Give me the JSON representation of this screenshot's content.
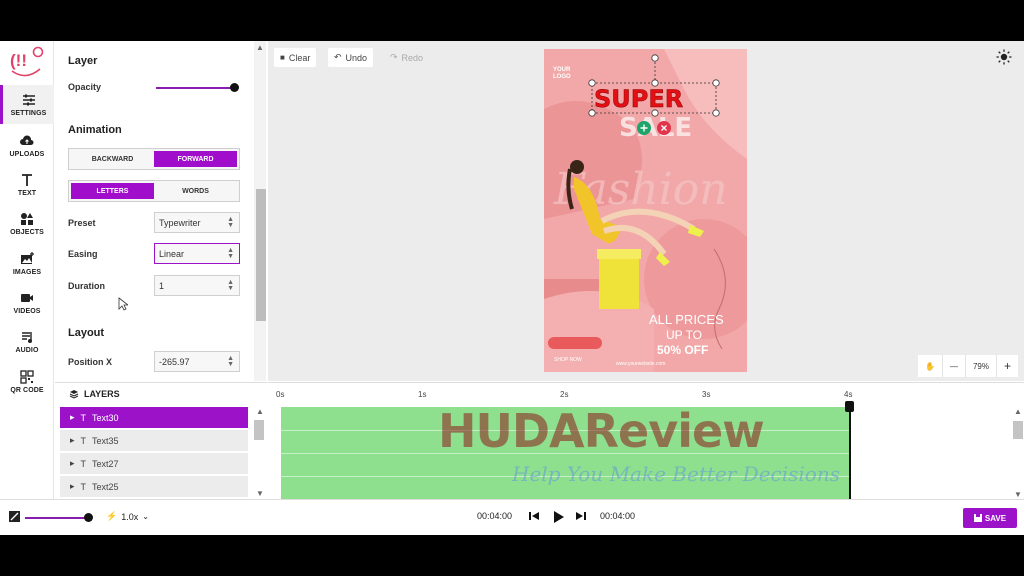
{
  "rail": {
    "items": [
      {
        "label": "SETTINGS",
        "icon": "sliders-icon",
        "active": true
      },
      {
        "label": "UPLOADS",
        "icon": "cloud-upload-icon"
      },
      {
        "label": "TEXT",
        "icon": "text-icon"
      },
      {
        "label": "OBJECTS",
        "icon": "shapes-icon"
      },
      {
        "label": "IMAGES",
        "icon": "image-icon"
      },
      {
        "label": "VIDEOS",
        "icon": "video-icon"
      },
      {
        "label": "AUDIO",
        "icon": "music-icon"
      },
      {
        "label": "QR CODE",
        "icon": "qr-code-icon"
      }
    ]
  },
  "settings": {
    "layer_title": "Layer",
    "opacity_label": "Opacity",
    "opacity_value": 1.0,
    "animation_title": "Animation",
    "direction_options": [
      "BACKWARD",
      "FORWARD"
    ],
    "direction_selected": "FORWARD",
    "unit_options": [
      "LETTERS",
      "WORDS"
    ],
    "unit_selected": "LETTERS",
    "preset_label": "Preset",
    "preset_value": "Typewriter",
    "easing_label": "Easing",
    "easing_value": "Linear",
    "duration_label": "Duration",
    "duration_value": "1",
    "layout_title": "Layout",
    "position_x_label": "Position X",
    "position_x_value": "-265.97"
  },
  "layers": {
    "title": "LAYERS",
    "items": [
      {
        "name": "Text30",
        "selected": true
      },
      {
        "name": "Text35"
      },
      {
        "name": "Text27"
      },
      {
        "name": "Text25"
      }
    ]
  },
  "toolbar": {
    "clear": "Clear",
    "undo": "Undo",
    "redo": "Redo"
  },
  "artboard": {
    "logo_text": "YOUR LOGO",
    "super_text": "SUPER",
    "sale_text": "SALE",
    "fashion_text": "Fashion",
    "all_prices": "ALL PRICES",
    "up_to": "UP TO",
    "discount": "50% OFF",
    "shop_now": "SHOP NOW",
    "website": "www.yourwebsite.com"
  },
  "zoom": {
    "value": "79%"
  },
  "timeline": {
    "ticks": [
      "0s",
      "1s",
      "2s",
      "3s",
      "4s"
    ]
  },
  "bottom": {
    "speed": "1.0x",
    "current_time": "00:04:00",
    "total_time": "00:04:00",
    "save": "SAVE"
  },
  "watermark": {
    "brand": "HUDAReview",
    "tagline": "Help You Make Better Decisions"
  },
  "colors": {
    "accent": "#9b12c9",
    "track": "#8ee08e",
    "artboard_bg": "#f2a8a9"
  }
}
